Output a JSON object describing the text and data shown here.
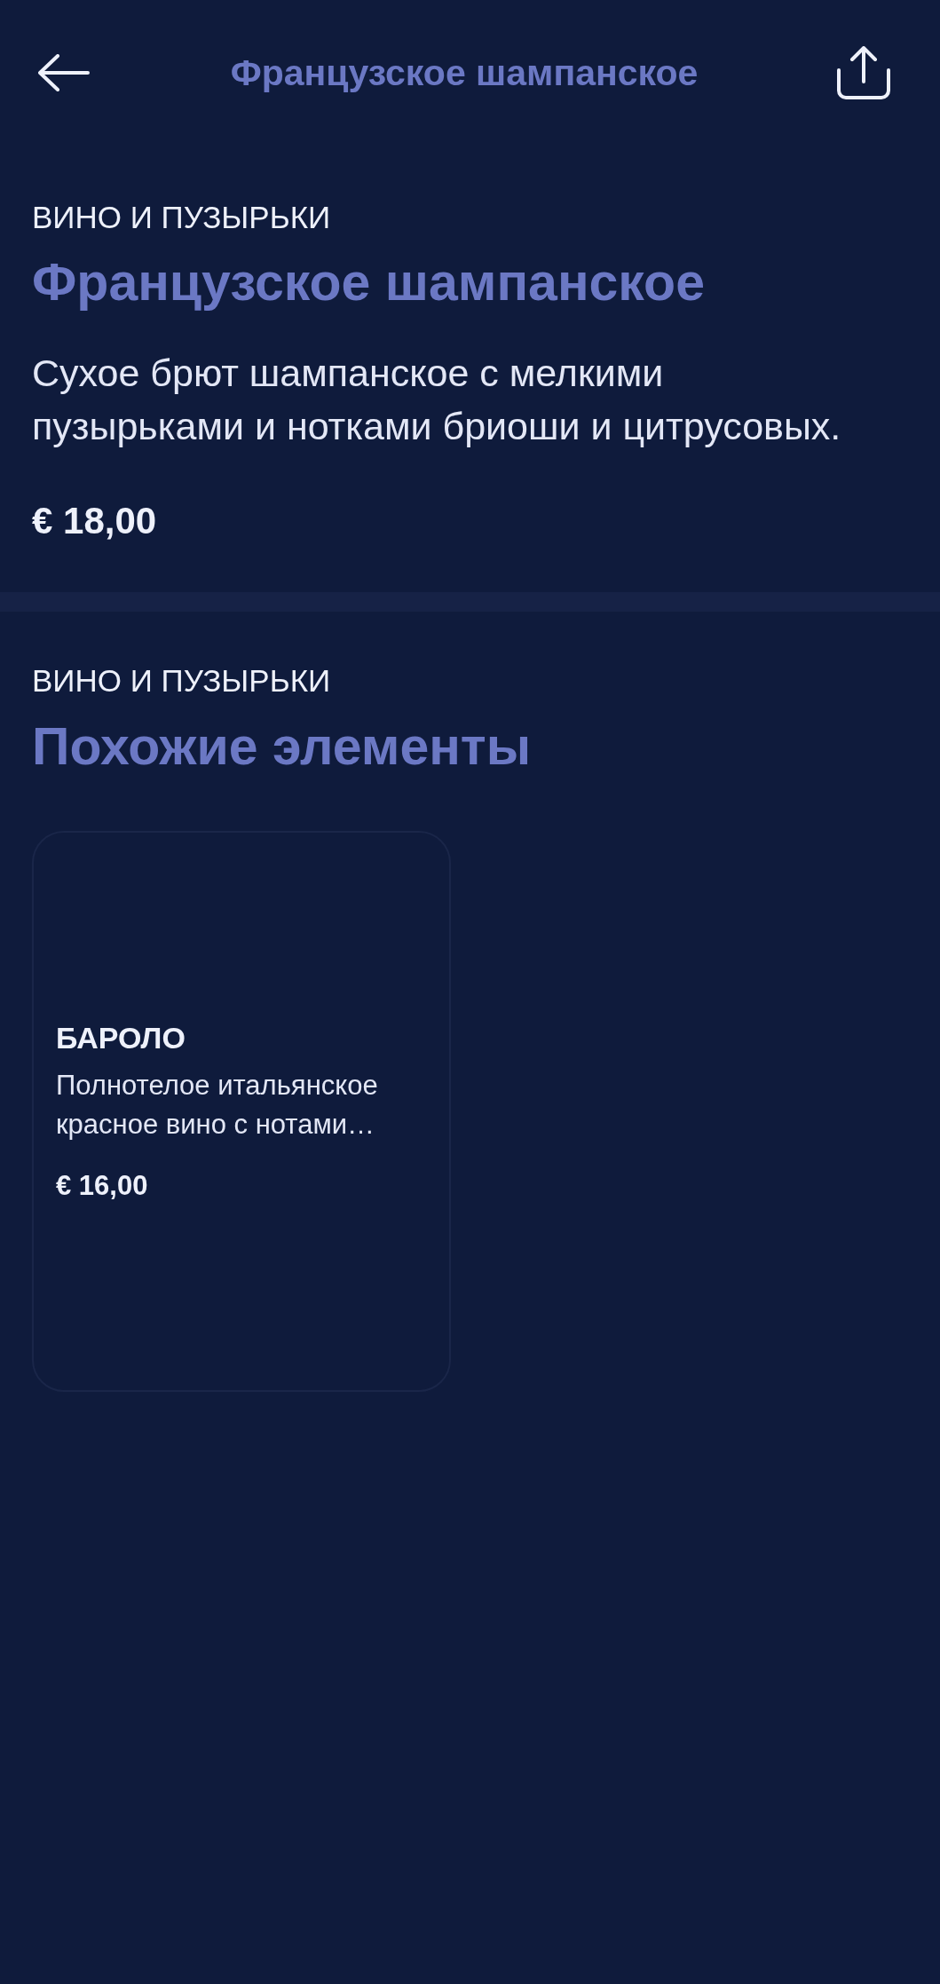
{
  "header": {
    "title": "Французское шампанское"
  },
  "product": {
    "category": "ВИНО И ПУЗЫРЬКИ",
    "name": "Французское шампанское",
    "description": "Сухое брют шампанское с мелкими пузырьками и нотками бриоши и цитрусовых.",
    "price": "€ 18,00"
  },
  "similar": {
    "category": "ВИНО И ПУЗЫРЬКИ",
    "title": "Похожие элементы",
    "items": [
      {
        "name": "БАРОЛО",
        "description": "Полнотелое итальянское красное вино с нотами…",
        "price": "€ 16,00"
      }
    ]
  }
}
